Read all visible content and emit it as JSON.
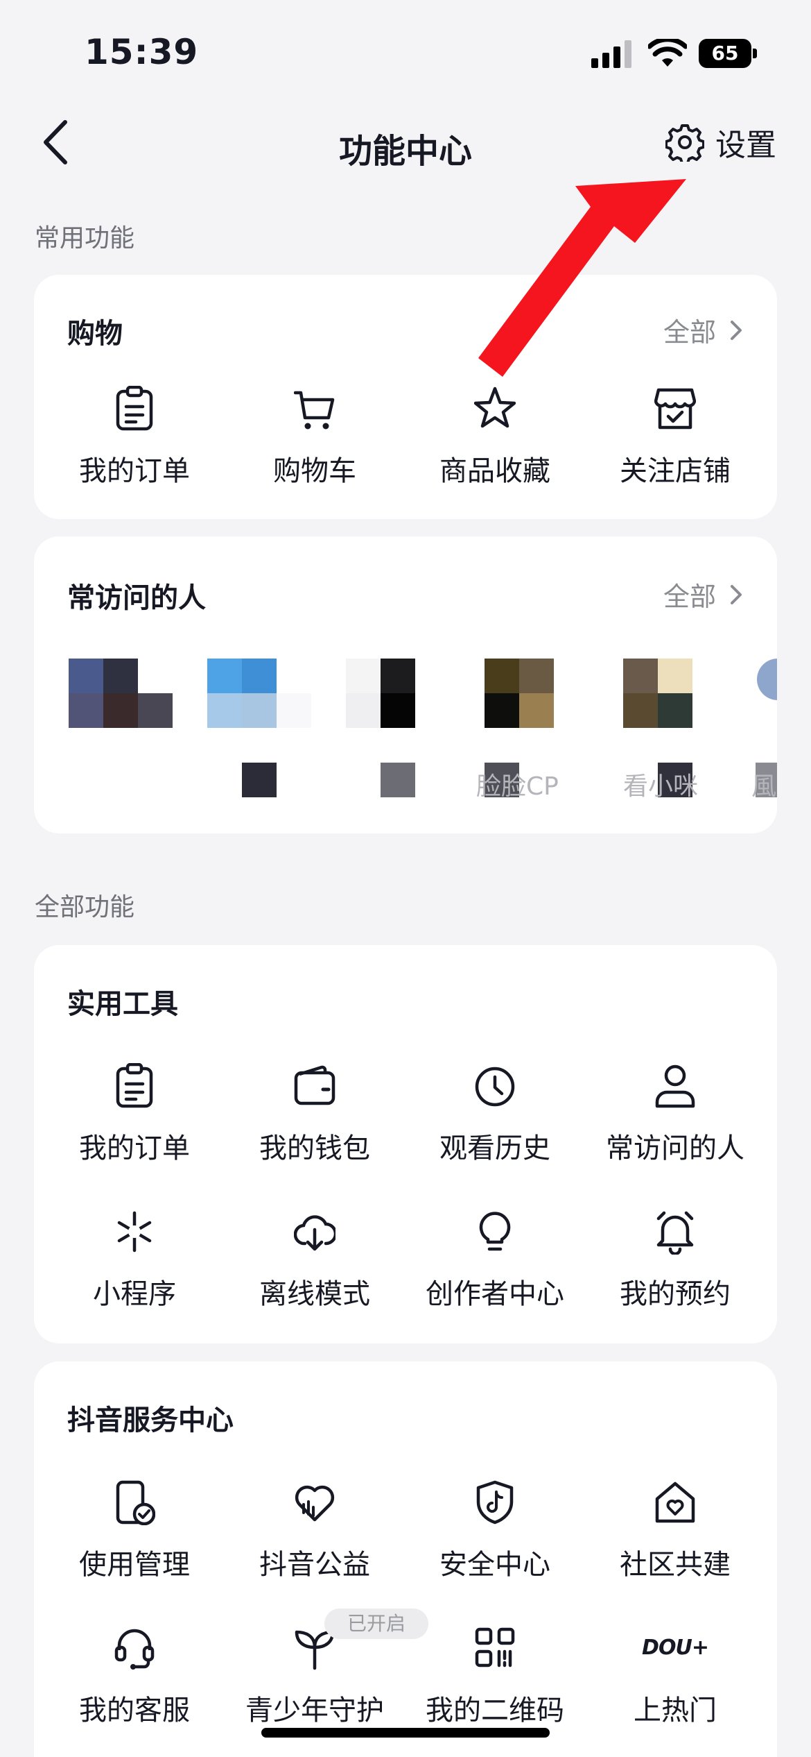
{
  "status_bar": {
    "time": "15:39",
    "battery": "65"
  },
  "nav": {
    "title": "功能中心",
    "settings_label": "设置"
  },
  "common_section": {
    "label": "常用功能"
  },
  "shopping_card": {
    "title": "购物",
    "more_label": "全部",
    "items": [
      {
        "label": "我的订单",
        "icon": "order-list-icon"
      },
      {
        "label": "购物车",
        "icon": "shopping-cart-icon"
      },
      {
        "label": "商品收藏",
        "icon": "star-icon"
      },
      {
        "label": "关注店铺",
        "icon": "store-check-icon"
      }
    ]
  },
  "frequent_card": {
    "title": "常访问的人",
    "more_label": "全部",
    "contacts": [
      {
        "name": ""
      },
      {
        "name": ""
      },
      {
        "name": ""
      },
      {
        "name": "脸脸CP"
      },
      {
        "name": "看小咪"
      },
      {
        "name": "風"
      }
    ]
  },
  "all_section": {
    "label": "全部功能"
  },
  "tools_card": {
    "title": "实用工具",
    "items": [
      {
        "label": "我的订单",
        "icon": "order-list-icon"
      },
      {
        "label": "我的钱包",
        "icon": "wallet-icon"
      },
      {
        "label": "观看历史",
        "icon": "clock-icon"
      },
      {
        "label": "常访问的人",
        "icon": "person-icon"
      },
      {
        "label": "小程序",
        "icon": "mini-program-icon"
      },
      {
        "label": "离线模式",
        "icon": "cloud-download-icon"
      },
      {
        "label": "创作者中心",
        "icon": "lightbulb-icon"
      },
      {
        "label": "我的预约",
        "icon": "alarm-bell-icon"
      }
    ]
  },
  "service_card": {
    "title": "抖音服务中心",
    "items": [
      {
        "label": "使用管理",
        "icon": "phone-check-icon"
      },
      {
        "label": "抖音公益",
        "icon": "charity-heart-icon"
      },
      {
        "label": "安全中心",
        "icon": "shield-tiktok-icon"
      },
      {
        "label": "社区共建",
        "icon": "home-heart-icon"
      },
      {
        "label": "我的客服",
        "icon": "headset-icon"
      },
      {
        "label": "青少年守护",
        "icon": "sprout-icon",
        "badge": "已开启"
      },
      {
        "label": "我的二维码",
        "icon": "qr-code-icon"
      },
      {
        "label": "上热门",
        "icon": "dou-plus-icon",
        "icon_text": "DOU+"
      }
    ]
  },
  "colors": {
    "background": "#f4f4f6",
    "card": "#ffffff",
    "text": "#161823",
    "muted": "#8a8b91",
    "annotation_arrow": "#f5151f"
  }
}
